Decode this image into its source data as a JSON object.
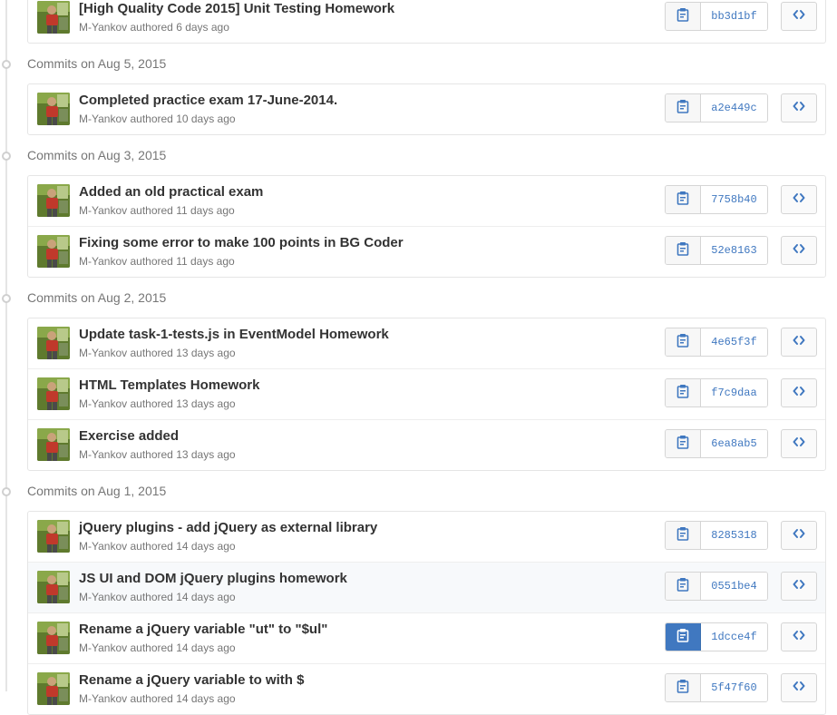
{
  "colors": {
    "accent": "#4078c0",
    "text": "#333333",
    "muted": "#767676",
    "border": "#e5e5e5",
    "highlight_row": "#f7f9fb"
  },
  "icons": {
    "copy": "clippy-icon",
    "browse": "code-icon",
    "timeline": "commit-dot-icon"
  },
  "groups": [
    {
      "header": "",
      "commits": [
        {
          "message": "[High Quality Code 2015] Unit Testing Homework",
          "author": "M-Yankov",
          "meta": "authored 6 days ago",
          "sha": "bb3d1bf"
        }
      ]
    },
    {
      "header": "Commits on Aug 5, 2015",
      "commits": [
        {
          "message": "Completed practice exam 17-June-2014.",
          "author": "M-Yankov",
          "meta": "authored 10 days ago",
          "sha": "a2e449c"
        }
      ]
    },
    {
      "header": "Commits on Aug 3, 2015",
      "commits": [
        {
          "message": "Added an old practical exam",
          "author": "M-Yankov",
          "meta": "authored 11 days ago",
          "sha": "7758b40"
        },
        {
          "message": "Fixing some error to make 100 points in BG Coder",
          "author": "M-Yankov",
          "meta": "authored 11 days ago",
          "sha": "52e8163"
        }
      ]
    },
    {
      "header": "Commits on Aug 2, 2015",
      "commits": [
        {
          "message": "Update task-1-tests.js in EventModel Homework",
          "author": "M-Yankov",
          "meta": "authored 13 days ago",
          "sha": "4e65f3f"
        },
        {
          "message": "HTML Templates Homework",
          "author": "M-Yankov",
          "meta": "authored 13 days ago",
          "sha": "f7c9daa"
        },
        {
          "message": "Exercise added",
          "author": "M-Yankov",
          "meta": "authored 13 days ago",
          "sha": "6ea8ab5"
        }
      ]
    },
    {
      "header": "Commits on Aug 1, 2015",
      "commits": [
        {
          "message": "jQuery plugins - add jQuery as external library",
          "author": "M-Yankov",
          "meta": "authored 14 days ago",
          "sha": "8285318"
        },
        {
          "message": "JS UI and DOM jQuery plugins homework",
          "author": "M-Yankov",
          "meta": "authored 14 days ago",
          "sha": "0551be4"
        },
        {
          "message": "Rename a jQuery variable \"ut\" to \"$ul\"",
          "author": "M-Yankov",
          "meta": "authored 14 days ago",
          "sha": "1dcce4f"
        },
        {
          "message": "Rename a jQuery variable to with $",
          "author": "M-Yankov",
          "meta": "authored 14 days ago",
          "sha": "5f47f60"
        }
      ]
    }
  ]
}
